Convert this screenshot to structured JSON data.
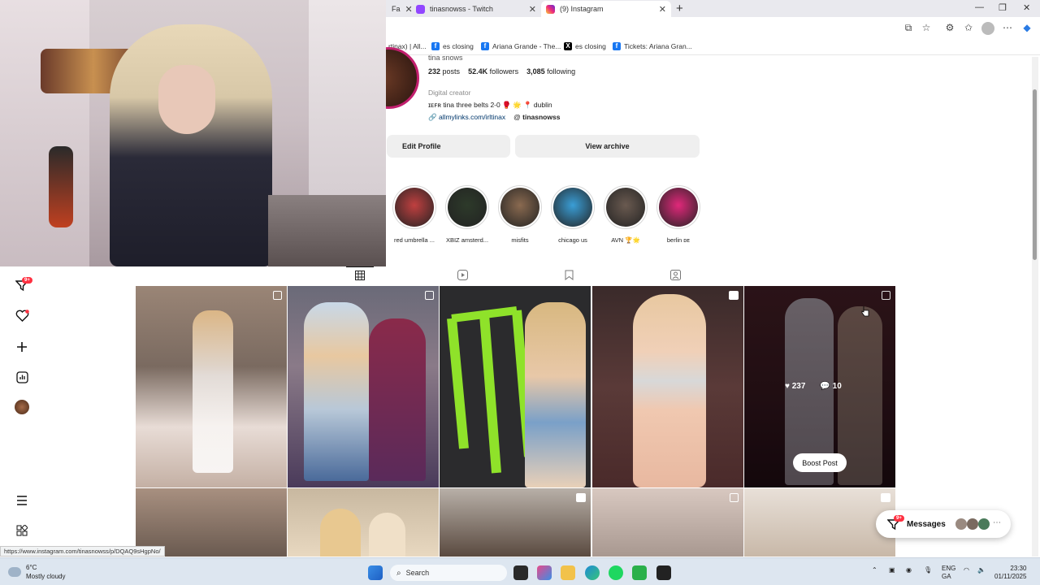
{
  "browser": {
    "tabs": [
      {
        "label": "Fa",
        "active": false
      },
      {
        "label": "tinasnowss - Twitch",
        "active": false
      },
      {
        "label": "(9) Instagram",
        "active": true
      }
    ],
    "bookmarks": [
      {
        "label": "rtinax) | All...",
        "icon": "page-icon"
      },
      {
        "label": "es closing",
        "icon": "facebook-icon"
      },
      {
        "label": "Ariana Grande - The...",
        "icon": "facebook-icon"
      },
      {
        "label": "es closing",
        "icon": "x-icon"
      },
      {
        "label": "Tickets: Ariana Gran...",
        "icon": "facebook-icon"
      }
    ],
    "status_url": "https://www.instagram.com/tinasnowss/p/DQAQ9sHgpNo/"
  },
  "profile": {
    "username_partial": "tina snows",
    "posts": "232",
    "posts_label": "posts",
    "followers": "52.4K",
    "followers_label": "followers",
    "following": "3,085",
    "following_label": "following",
    "category": "Digital creator",
    "bio": "ɪᴇꜰʀ tina three belts 2-0 🥊 🌟 📍 dublin",
    "link": "allmylinks.com/irltinax",
    "threads": "tinasnowss",
    "edit_label": "Edit Profile",
    "archive_label": "View archive"
  },
  "highlights": [
    {
      "label": "red umbrella ...",
      "color": "#c04040"
    },
    {
      "label": "XBIZ amsterd...",
      "color": "#2d3a2a"
    },
    {
      "label": "misfits",
      "color": "#8a6a50"
    },
    {
      "label": "chicago us",
      "color": "#3a9ed6"
    },
    {
      "label": "AVN 🏆🌟",
      "color": "#6a5a50"
    },
    {
      "label": "berlin ᴅᴇ",
      "color": "#e0287a"
    }
  ],
  "hover": {
    "likes": "237",
    "comments": "10",
    "boost_label": "Boost Post"
  },
  "messages": {
    "label": "Messages",
    "badge": "9+"
  },
  "sidebar": {
    "notif_badge": "9+"
  },
  "taskbar": {
    "temp": "6°C",
    "weather": "Mostly cloudy",
    "search_placeholder": "Search",
    "lang1": "ENG",
    "lang2": "GA",
    "time": "23:30",
    "date": "01/11/2025"
  }
}
